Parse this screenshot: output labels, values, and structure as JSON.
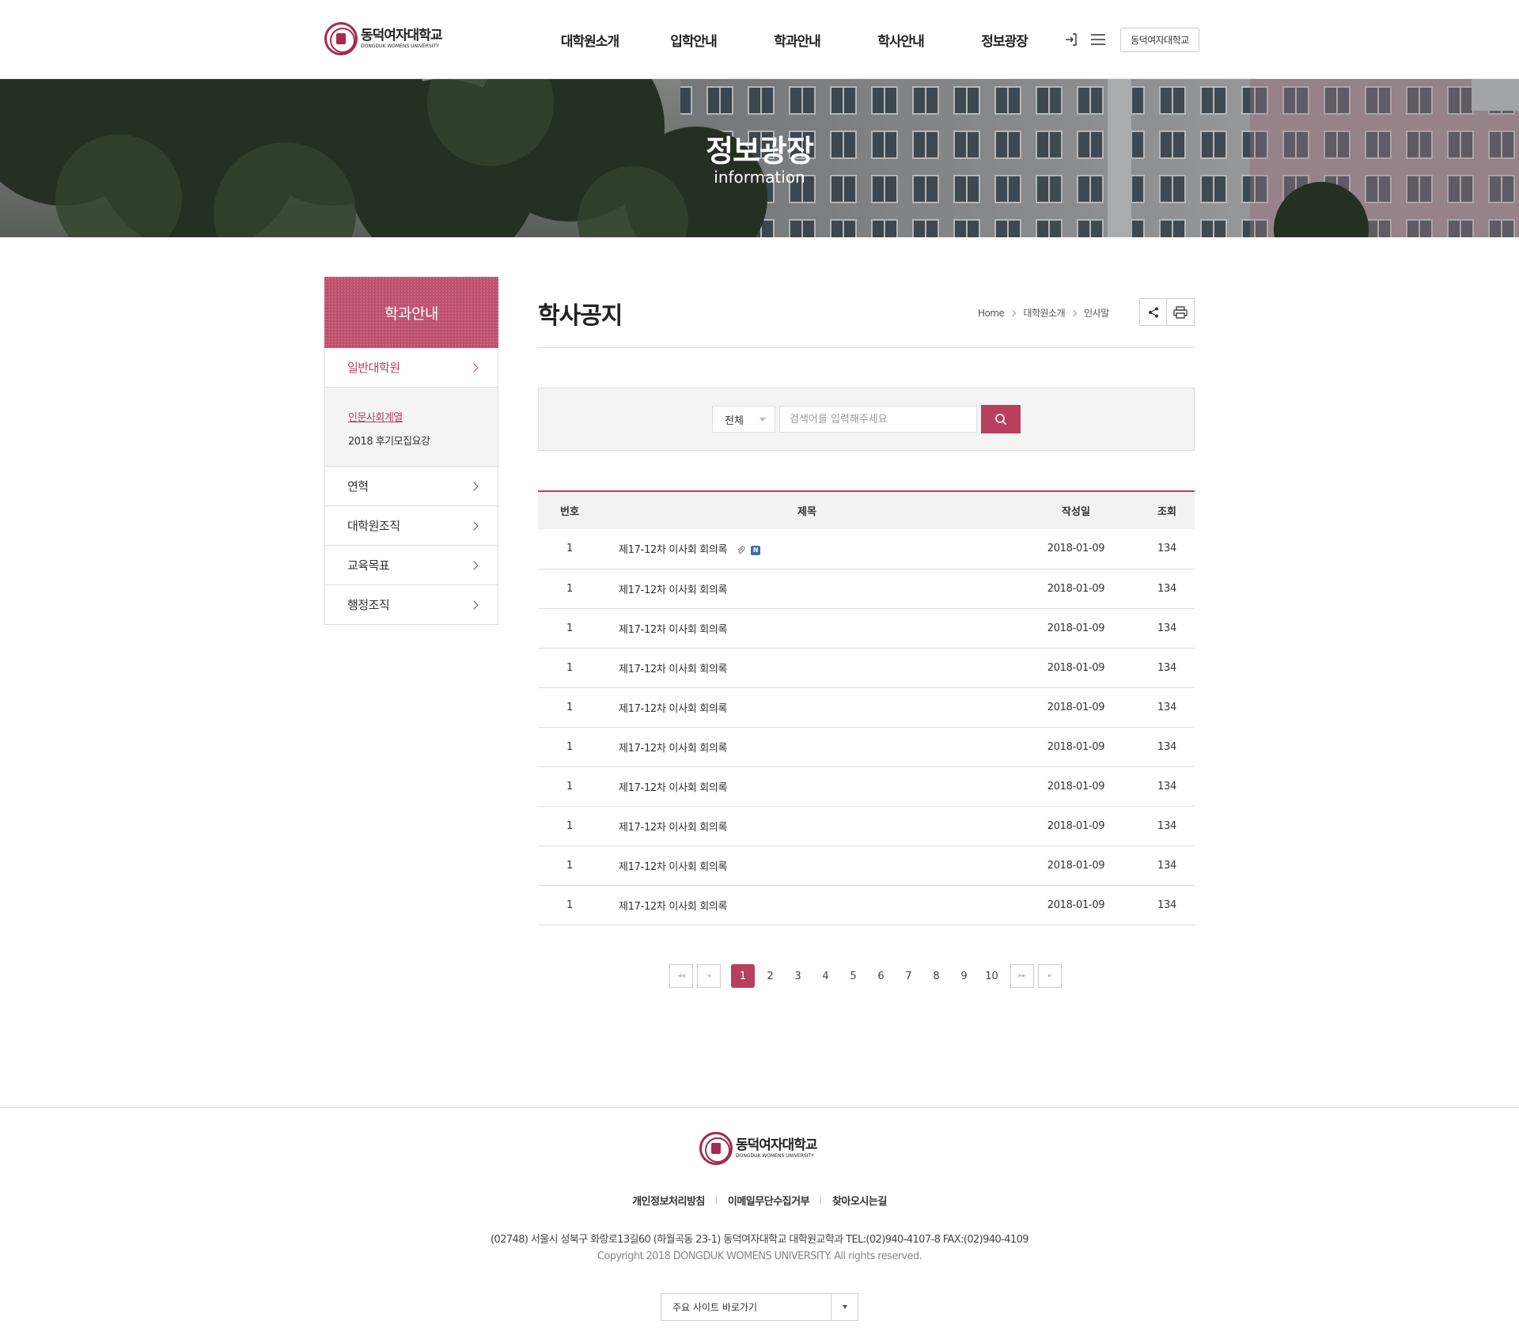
{
  "brand": {
    "name_ko": "동덕여자대학교",
    "name_en": "DONGDUK WOMENS UNIVERSITY",
    "accent_color": "#b8405e"
  },
  "gnb": {
    "items": [
      "대학원소개",
      "입학안내",
      "학과안내",
      "학사안내",
      "정보광장"
    ]
  },
  "util": {
    "login_icon": "login-icon",
    "menu_icon": "hamburger-menu-icon",
    "univ_button": "동덕여자대학교"
  },
  "hero": {
    "title": "정보광장",
    "subtitle": "information"
  },
  "lnb": {
    "title": "학과안내",
    "items": [
      {
        "label": "일반대학원",
        "active": true
      },
      {
        "label": "연혁"
      },
      {
        "label": "대학원조직"
      },
      {
        "label": "교육목표"
      },
      {
        "label": "행정조직"
      }
    ],
    "sub_items": [
      {
        "label": "인문사회계열",
        "active": true
      },
      {
        "label": "2018 후기모집요강"
      }
    ]
  },
  "content": {
    "page_title": "학사공지",
    "breadcrumb": [
      "Home",
      "대학원소개",
      "인사말"
    ],
    "share_icon": "share-icon",
    "print_icon": "print-icon"
  },
  "search": {
    "select_value": "전체",
    "placeholder": "검색어를 입력해주세요",
    "button_icon": "search-icon"
  },
  "board": {
    "headers": [
      "번호",
      "제목",
      "작성일",
      "조회"
    ],
    "rows": [
      {
        "num": "1",
        "title": "제17-12차 이사회 회의록",
        "date": "2018-01-09",
        "hits": "134",
        "attach": true,
        "new_badge": "N"
      },
      {
        "num": "1",
        "title": "제17-12차 이사회 회의록",
        "date": "2018-01-09",
        "hits": "134"
      },
      {
        "num": "1",
        "title": "제17-12차 이사회 회의록",
        "date": "2018-01-09",
        "hits": "134"
      },
      {
        "num": "1",
        "title": "제17-12차 이사회 회의록",
        "date": "2018-01-09",
        "hits": "134"
      },
      {
        "num": "1",
        "title": "제17-12차 이사회 회의록",
        "date": "2018-01-09",
        "hits": "134"
      },
      {
        "num": "1",
        "title": "제17-12차 이사회 회의록",
        "date": "2018-01-09",
        "hits": "134"
      },
      {
        "num": "1",
        "title": "제17-12차 이사회 회의록",
        "date": "2018-01-09",
        "hits": "134"
      },
      {
        "num": "1",
        "title": "제17-12차 이사회 회의록",
        "date": "2018-01-09",
        "hits": "134"
      },
      {
        "num": "1",
        "title": "제17-12차 이사회 회의록",
        "date": "2018-01-09",
        "hits": "134"
      },
      {
        "num": "1",
        "title": "제17-12차 이사회 회의록",
        "date": "2018-01-09",
        "hits": "134"
      }
    ]
  },
  "pagination": {
    "pages": [
      "1",
      "2",
      "3",
      "4",
      "5",
      "6",
      "7",
      "8",
      "9",
      "10"
    ],
    "current": "1",
    "first_glyph": "◂◂",
    "prev_glyph": "◂",
    "next_glyph": "▸▸",
    "last_glyph": "▸"
  },
  "footer": {
    "links": [
      "개인정보처리방침",
      "이메일무단수집거부",
      "찾아오시는길"
    ],
    "address": "(02748) 서울시 성북구 화랑로13길60 (하월곡동 23-1) 동덕여자대학교 대학원교학과 TEL:(02)940-4107-8 FAX:(02)940-4109",
    "copyright": "Copyright 2018 DONGDUK WOMENS UNIVERSITY. All rights reserved.",
    "site_select": "주요 사이트 바로가기"
  }
}
